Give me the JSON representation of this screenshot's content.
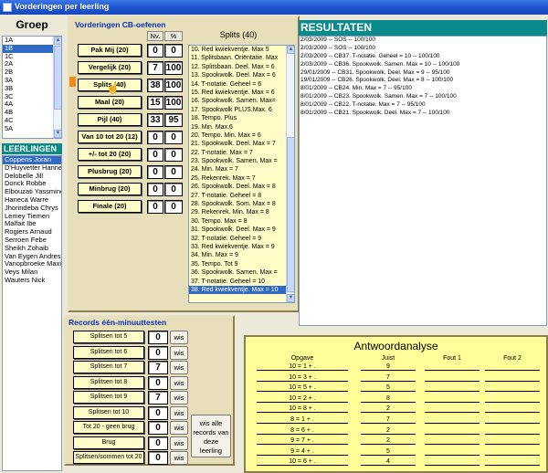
{
  "window": {
    "title": "Vorderingen per leerling"
  },
  "groep": {
    "title": "Groep",
    "items": [
      "1A",
      "1B",
      "1C",
      "2A",
      "2B",
      "3A",
      "3B",
      "3C",
      "4A",
      "4B",
      "4C",
      "5A"
    ],
    "selected": 1
  },
  "leerlingen": {
    "title": "LEERLINGEN",
    "items": [
      "Coppens Joran",
      "D'Huyvetter Hanne",
      "Delobelle Jill",
      "Donck Robbe",
      "Elbouzati Yassmine",
      "Haneca Warre",
      "Jhorindeba Chrys",
      "Lemey Tiemen",
      "Malfait Ibe",
      "Rogiers Arnaud",
      "Serroen Febe",
      "Sheikh Zohaib",
      "Van Eygen Andres",
      "Vanopbroeke Maxi",
      "Veys Milan",
      "Wauters Nick"
    ],
    "selected": 0
  },
  "vorderingen": {
    "title": "Vorderingen CB-oefenen",
    "col_nv": "Nv.",
    "col_pct": "%",
    "rows": [
      {
        "label": "Pak Mij (20)",
        "nv": "0",
        "pct": "0"
      },
      {
        "label": "Vergelijk (20)",
        "nv": "7",
        "pct": "100"
      },
      {
        "label": "Splits (40)",
        "nv": "38",
        "pct": "100"
      },
      {
        "label": "Maal (20)",
        "nv": "15",
        "pct": "100"
      },
      {
        "label": "Pijl (40)",
        "nv": "33",
        "pct": "95"
      },
      {
        "label": "Van 10 tot 20 (12)",
        "nv": "0",
        "pct": "0"
      },
      {
        "label": "+/- tot 20 (20)",
        "nv": "0",
        "pct": "0"
      },
      {
        "label": "Plusbrug (20)",
        "nv": "0",
        "pct": "0"
      },
      {
        "label": "Minbrug (20)",
        "nv": "0",
        "pct": "0"
      },
      {
        "label": "Finale (20)",
        "nv": "0",
        "pct": "0"
      }
    ]
  },
  "splits": {
    "title": "Splits (40)",
    "items": [
      "10. Red kwiekventje. Max 5",
      "11. Splitsbaan. Oriëntatie. Max",
      "12. Splitsbaan. Deel. Max = 6",
      "13. Spookwolk. Deel. Max = 6",
      "14. T-notatie. Geheel = 6",
      "15. Red kwiekventje. Max = 6",
      "16. Spookwolk. Samen. Max=",
      "17. Spookwolk PLUS.Max. 6",
      "18. Tempo. Plus",
      "19. Min. Max.6",
      "20. Tempo. Min. Max = 6",
      "21. Spookwolk. Deel. Max = 7",
      "22. T-notatie. Max = 7",
      "23. Spookwolk. Samen. Max =",
      "24. Min. Max = 7",
      "25. Rekenrek. Max = 7",
      "26. Spookwolk. Deel. Max = 8",
      "27. T-notatie. Geheel = 8",
      "28. Spookwolk. Som. Max = 8",
      "29. Rekenrek. Min. Max = 8",
      "30. Tempo. Max = 8",
      "31. Spookwolk. Deel. Max = 9",
      "32. T-notatie. Geheel = 9",
      "33. Red kwiekventje. Max = 9",
      "34. Min. Max = 9",
      "35. Tempo. Tot 9",
      "36. Spookwolk. Samen. Max =",
      "37. T-notatie. Geheel = 10",
      "38. Red kwiekventje. Max = 10"
    ],
    "selected": 28
  },
  "records": {
    "title": "Records één-minuuttesten",
    "wis_label": "wis",
    "wis_all_label": "wis alle records van deze leerling",
    "rows": [
      {
        "label": "Splitsen tot 5",
        "value": "0"
      },
      {
        "label": "Splitsen tot 6",
        "value": "0"
      },
      {
        "label": "Splitsen tot 7",
        "value": "7"
      },
      {
        "label": "Splitsen tot 8",
        "value": "0"
      },
      {
        "label": "Splitsen tot 9",
        "value": "7"
      },
      {
        "label": "Splitsen tot 10",
        "value": "0"
      },
      {
        "label": "Tot 20 - geen brug",
        "value": "0"
      },
      {
        "label": "Brug",
        "value": "0"
      },
      {
        "label": "Splitsen/sommen tot 20",
        "value": "0"
      }
    ]
  },
  "resultaten": {
    "title": "RESULTATEN",
    "items": [
      "2/03/2009  --  SOS -- 100/100",
      "2/03/2009  --  SOS -- 100/100",
      "2/03/2009  --  CB37. T-notatie. Geheel = 10 -- 100/100",
      "2/03/2009  --  CB36. Spookwolk. Samen. Max = 10 -- 100/100",
      "29/01/2009  --  CB31. Spookwolk. Deel. Max = 9 -- 95/100",
      "19/01/2009  --  CB26. Spookwolk. Deel. Max = 8 -- 100/100",
      "8/01/2009  --  CB24. Min. Max = 7 -- 95/100",
      "8/01/2009  --  CB23. Spookwolk. Samen. Max = 7 -- 100/100",
      "8/01/2009  --  CB22. T-notatie. Max = 7 -- 95/100",
      "8/01/2009  --  CB21. Spookwolk. Deel. Max = 7 -- 100/100"
    ]
  },
  "antwoord": {
    "title": "Antwoordanalyse",
    "headers": [
      "Opgave",
      "Juist",
      "Fout 1",
      "Fout 2"
    ],
    "rows": [
      {
        "opgave": "10 = 1 + .",
        "juist": "9"
      },
      {
        "opgave": "10 = 3 + .",
        "juist": "7"
      },
      {
        "opgave": "10 = 5 + .",
        "juist": "5"
      },
      {
        "opgave": "10 = 2 + .",
        "juist": "8"
      },
      {
        "opgave": "10 = 8 + .",
        "juist": "2"
      },
      {
        "opgave": "8 = 1 + .",
        "juist": "7"
      },
      {
        "opgave": "8 = 6 + .",
        "juist": "2"
      },
      {
        "opgave": "9 = 7 + .",
        "juist": "2"
      },
      {
        "opgave": "9 = 4 + .",
        "juist": "5"
      },
      {
        "opgave": "10 = 6 + .",
        "juist": "4"
      }
    ]
  }
}
